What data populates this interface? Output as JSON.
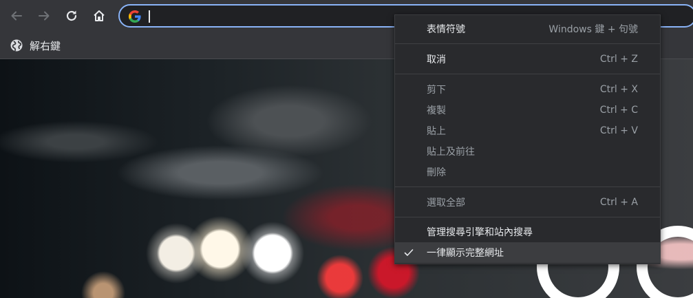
{
  "toolbar": {
    "back_icon": "back-arrow-icon",
    "forward_icon": "forward-arrow-icon",
    "reload_icon": "reload-icon",
    "home_icon": "home-icon"
  },
  "omnibox": {
    "value": "",
    "logo": "google-g-icon",
    "focus_color": "#8ab4f8"
  },
  "bookmarks": {
    "items": [
      {
        "label": "解右鍵",
        "icon": "globe-icon"
      }
    ]
  },
  "context_menu": {
    "emoji": {
      "label": "表情符號",
      "shortcut": "Windows 鍵 + 句號"
    },
    "undo": {
      "label": "取消",
      "shortcut": "Ctrl + Z"
    },
    "cut": {
      "label": "剪下",
      "shortcut": "Ctrl + X"
    },
    "copy": {
      "label": "複製",
      "shortcut": "Ctrl + C"
    },
    "paste": {
      "label": "貼上",
      "shortcut": "Ctrl + V"
    },
    "paste_and_go": {
      "label": "貼上及前往"
    },
    "delete": {
      "label": "刪除"
    },
    "select_all": {
      "label": "選取全部",
      "shortcut": "Ctrl + A"
    },
    "manage_search": {
      "label": "管理搜尋引擎和站內搜尋"
    },
    "show_full_urls": {
      "label": "一律顯示完整網址",
      "checked": true
    }
  },
  "colors": {
    "toolbar_bg": "#35363a",
    "menu_bg": "#292a2d",
    "menu_highlight": "#3c3d40",
    "text": "#e8eaed",
    "text_disabled": "#9aa0a6"
  }
}
